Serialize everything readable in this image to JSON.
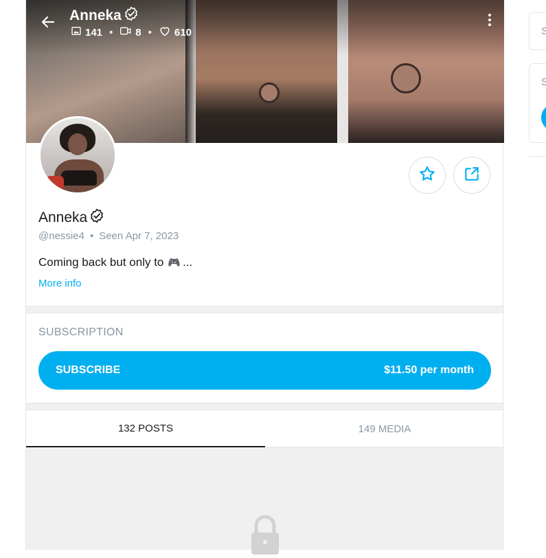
{
  "profile": {
    "display_name": "Anneka",
    "username": "@nessie4",
    "seen_label": "Seen",
    "seen_date": "Apr 7, 2023",
    "bio": "Coming back but only to",
    "bio_emoji": "🎮",
    "bio_ellipsis": "...",
    "more_info": "More info",
    "verified_icon": "verified-badge-icon"
  },
  "cover_stats": {
    "photos": "141",
    "videos": "8",
    "likes": "610"
  },
  "subscription": {
    "heading": "SUBSCRIPTION",
    "button_label": "SUBSCRIBE",
    "price": "$11.50 per month"
  },
  "tabs": [
    {
      "label": "132 POSTS",
      "active": true
    },
    {
      "label": "149 MEDIA",
      "active": false
    }
  ],
  "sidebar": {
    "card1_text": "S",
    "card2_text": "S"
  },
  "colors": {
    "accent": "#00aff0",
    "muted": "#8a96a3",
    "text": "#1a1a1a"
  }
}
